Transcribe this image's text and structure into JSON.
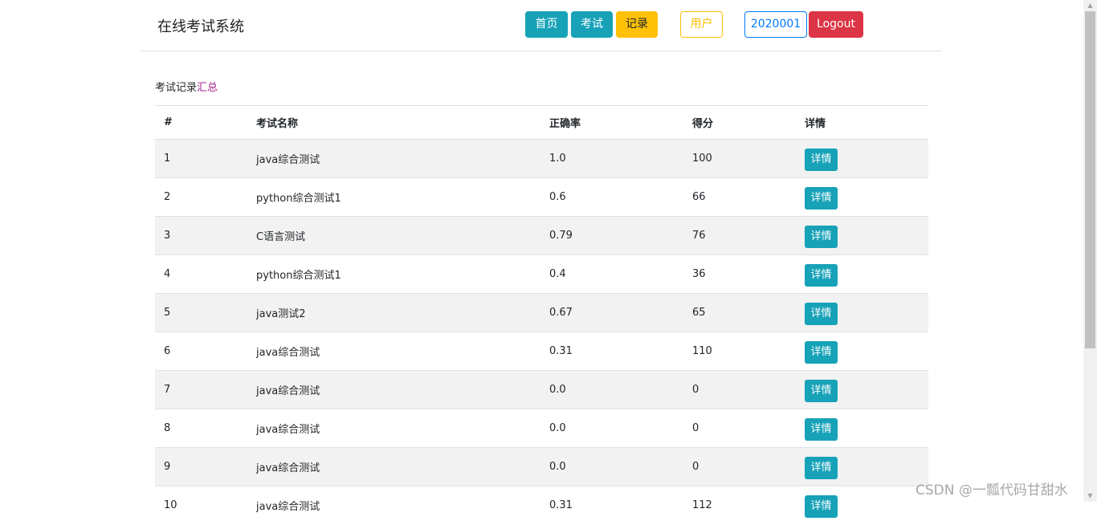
{
  "header": {
    "brand": "在线考试系统",
    "nav": {
      "home": "首页",
      "exam": "考试",
      "records": "记录",
      "user": "用户",
      "user_id": "2020001",
      "logout": "Logout"
    }
  },
  "caption": {
    "text": "考试记录",
    "accent": "汇总"
  },
  "table": {
    "columns": [
      "#",
      "考试名称",
      "正确率",
      "得分",
      "详情"
    ],
    "detail_label": "详情",
    "rows": [
      {
        "num": "1",
        "name": "java综合测试",
        "rate": "1.0",
        "score": "100"
      },
      {
        "num": "2",
        "name": "python综合测试1",
        "rate": "0.6",
        "score": "66"
      },
      {
        "num": "3",
        "name": "C语言测试",
        "rate": "0.79",
        "score": "76"
      },
      {
        "num": "4",
        "name": "python综合测试1",
        "rate": "0.4",
        "score": "36"
      },
      {
        "num": "5",
        "name": "java测试2",
        "rate": "0.67",
        "score": "65"
      },
      {
        "num": "6",
        "name": "java综合测试",
        "rate": "0.31",
        "score": "110"
      },
      {
        "num": "7",
        "name": "java综合测试",
        "rate": "0.0",
        "score": "0"
      },
      {
        "num": "8",
        "name": "java综合测试",
        "rate": "0.0",
        "score": "0"
      },
      {
        "num": "9",
        "name": "java综合测试",
        "rate": "0.0",
        "score": "0"
      },
      {
        "num": "10",
        "name": "java综合测试",
        "rate": "0.31",
        "score": "112"
      }
    ]
  },
  "watermark": "CSDN @一瓢代码甘甜水",
  "colors": {
    "info": "#17a2b8",
    "warning": "#ffc107",
    "primary": "#007bff",
    "danger": "#dc3545",
    "accent": "#a0218c"
  }
}
